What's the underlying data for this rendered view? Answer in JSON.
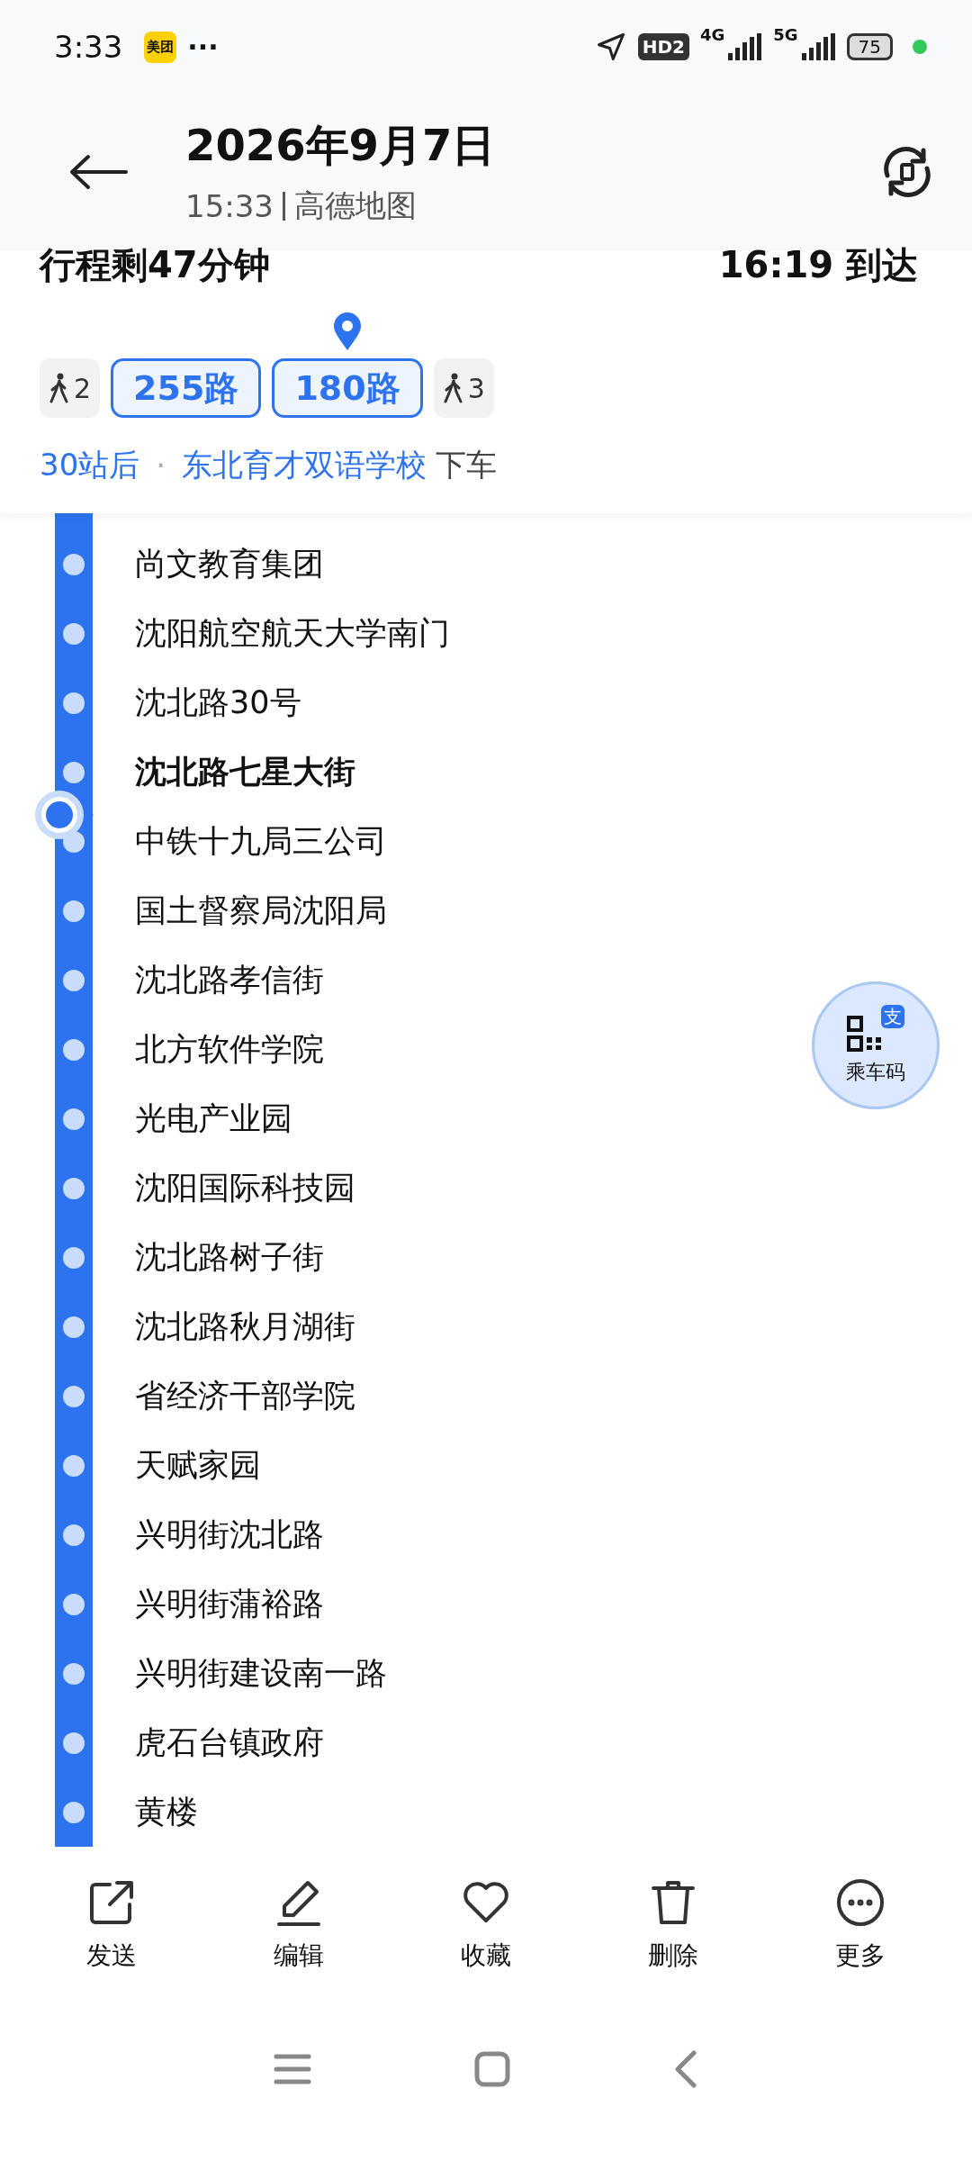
{
  "status_bar": {
    "time": "3:33",
    "app_badge": "美团",
    "more": "···",
    "hd": "HD2",
    "net1": "4G",
    "net2": "5G",
    "battery": "75"
  },
  "header": {
    "title": "2026年9月7日",
    "time": "15:33",
    "source": "高德地图"
  },
  "trip": {
    "remaining": "行程剩47分钟",
    "arrival": "16:19 到达",
    "segments": [
      {
        "kind": "walk",
        "label": "2",
        "selected": false
      },
      {
        "kind": "bus",
        "label": "255路",
        "selected": false
      },
      {
        "kind": "bus",
        "label": "180路",
        "selected": true
      },
      {
        "kind": "walk",
        "label": "3",
        "selected": false
      }
    ],
    "stops_after": "30站后",
    "dot": "·",
    "alight_stop": "东北育才双语学校",
    "alight_suffix": "下车"
  },
  "stops": [
    {
      "name": "尚文教育集团",
      "current": false
    },
    {
      "name": "沈阳航空航天大学南门",
      "current": false
    },
    {
      "name": "沈北路30号",
      "current": false
    },
    {
      "name": "沈北路七星大街",
      "current": true
    },
    {
      "name": "中铁十九局三公司",
      "current": false
    },
    {
      "name": "国土督察局沈阳局",
      "current": false
    },
    {
      "name": "沈北路孝信街",
      "current": false
    },
    {
      "name": "北方软件学院",
      "current": false
    },
    {
      "name": "光电产业园",
      "current": false
    },
    {
      "name": "沈阳国际科技园",
      "current": false
    },
    {
      "name": "沈北路树子街",
      "current": false
    },
    {
      "name": "沈北路秋月湖街",
      "current": false
    },
    {
      "name": "省经济干部学院",
      "current": false
    },
    {
      "name": "天赋家园",
      "current": false
    },
    {
      "name": "兴明街沈北路",
      "current": false
    },
    {
      "name": "兴明街蒲裕路",
      "current": false
    },
    {
      "name": "兴明街建设南一路",
      "current": false
    },
    {
      "name": "虎石台镇政府",
      "current": false
    },
    {
      "name": "黄楼",
      "current": false
    }
  ],
  "ride_code": {
    "label": "乘车码",
    "badge": "支"
  },
  "actions": [
    {
      "kind": "send",
      "label": "发送"
    },
    {
      "kind": "edit",
      "label": "编辑"
    },
    {
      "kind": "favorite",
      "label": "收藏"
    },
    {
      "kind": "delete",
      "label": "删除"
    },
    {
      "kind": "more",
      "label": "更多"
    }
  ]
}
